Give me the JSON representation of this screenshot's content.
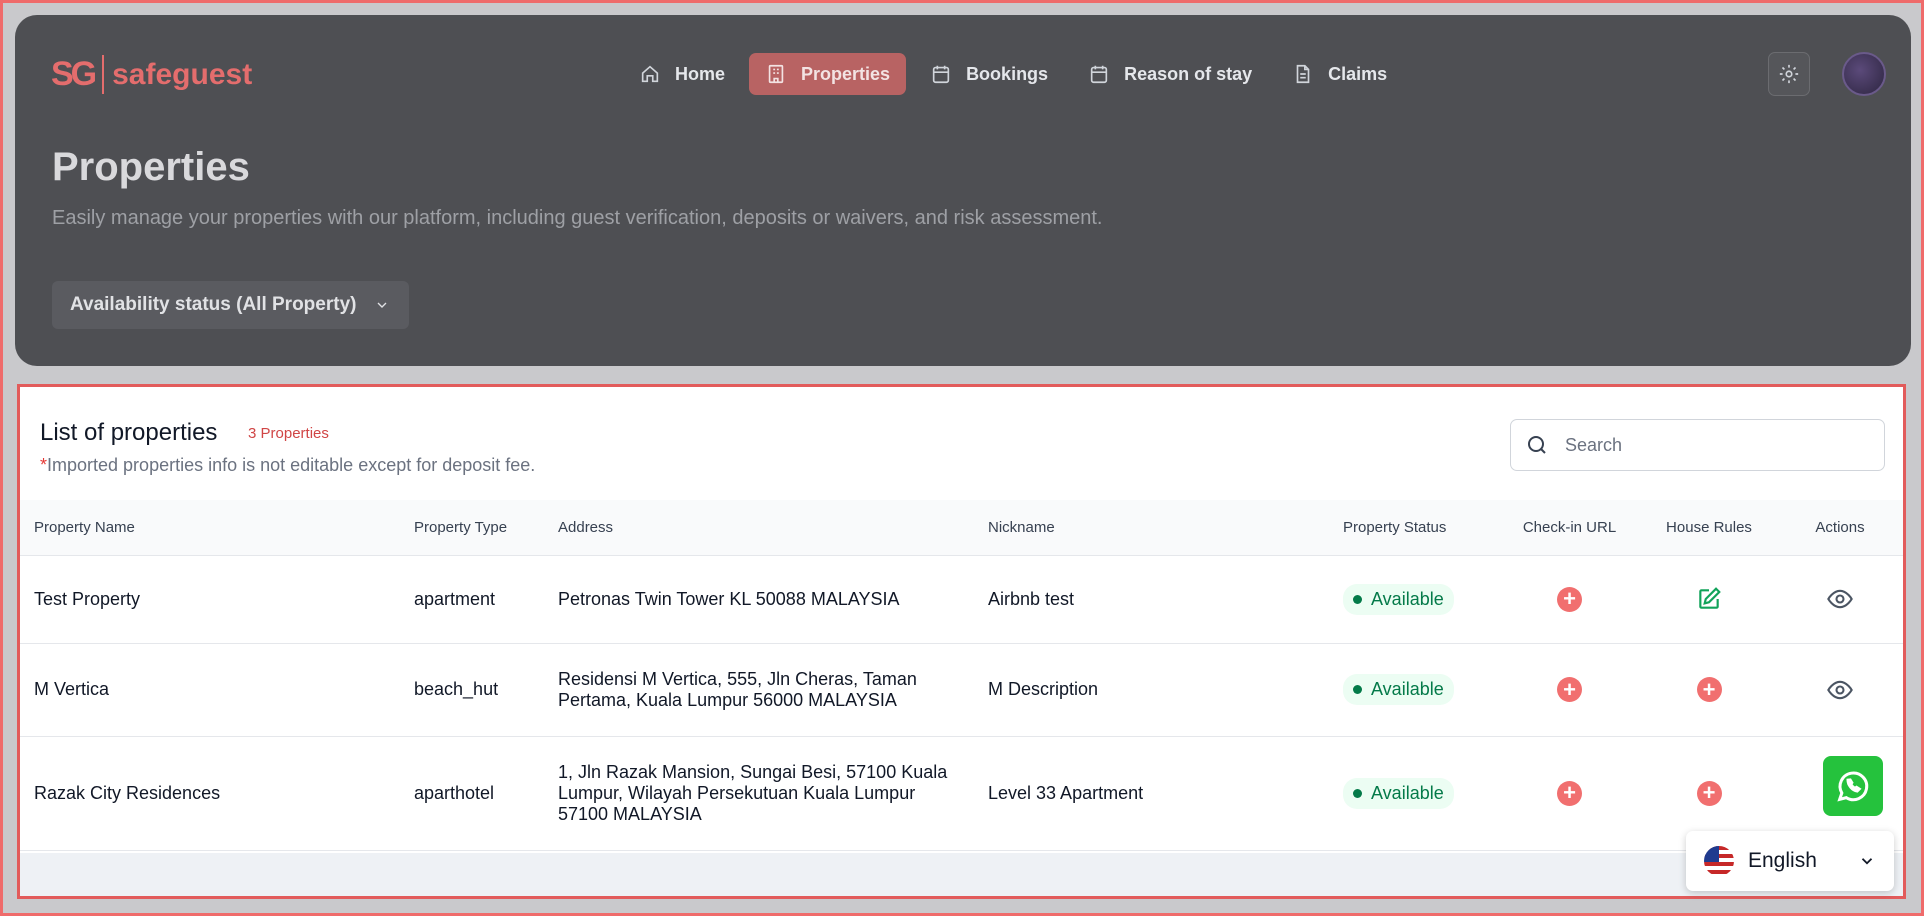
{
  "brand": {
    "logo_mark": "SG",
    "logo_text": "safeguest"
  },
  "nav": {
    "items": [
      {
        "label": "Home",
        "icon": "home-icon",
        "active": false
      },
      {
        "label": "Properties",
        "icon": "building-icon",
        "active": true
      },
      {
        "label": "Bookings",
        "icon": "calendar-icon",
        "active": false
      },
      {
        "label": "Reason of stay",
        "icon": "calendar-icon",
        "active": false
      },
      {
        "label": "Claims",
        "icon": "document-icon",
        "active": false
      }
    ]
  },
  "header": {
    "title": "Properties",
    "subtitle": "Easily manage your properties with our platform, including guest verification, deposits or waivers, and risk assessment.",
    "filter_label": "Availability status (All Property)"
  },
  "list": {
    "title": "List of properties",
    "count_label": "3 Properties",
    "note_star": "*",
    "note": "Imported properties info is not editable except for deposit fee.",
    "search_placeholder": "Search",
    "columns": [
      "Property Name",
      "Property Type",
      "Address",
      "Nickname",
      "Property Status",
      "Check-in URL",
      "House Rules",
      "Actions"
    ],
    "rows": [
      {
        "name": "Test Property",
        "type": "apartment",
        "address": "Petronas Twin Tower KL 50088 MALAYSIA",
        "nickname": "Airbnb test",
        "status": "Available",
        "checkin": "add",
        "rules": "edit",
        "action": "view"
      },
      {
        "name": "M Vertica",
        "type": "beach_hut",
        "address": "Residensi M Vertica, 555, Jln Cheras, Taman Pertama, Kuala Lumpur 56000 MALAYSIA",
        "nickname": "M Description",
        "status": "Available",
        "checkin": "add",
        "rules": "add",
        "action": "view"
      },
      {
        "name": "Razak City Residences",
        "type": "aparthotel",
        "address": "1, Jln Razak Mansion, Sungai Besi, 57100 Kuala Lumpur, Wilayah Persekutuan Kuala Lumpur 57100 MALAYSIA",
        "nickname": "Level 33 Apartment",
        "status": "Available",
        "checkin": "add",
        "rules": "add",
        "action": "view"
      }
    ]
  },
  "language": {
    "label": "English",
    "flag": "us-flag-icon"
  },
  "colors": {
    "accent": "#e46d6d",
    "status_green": "#047a49",
    "whatsapp": "#25c23d"
  }
}
